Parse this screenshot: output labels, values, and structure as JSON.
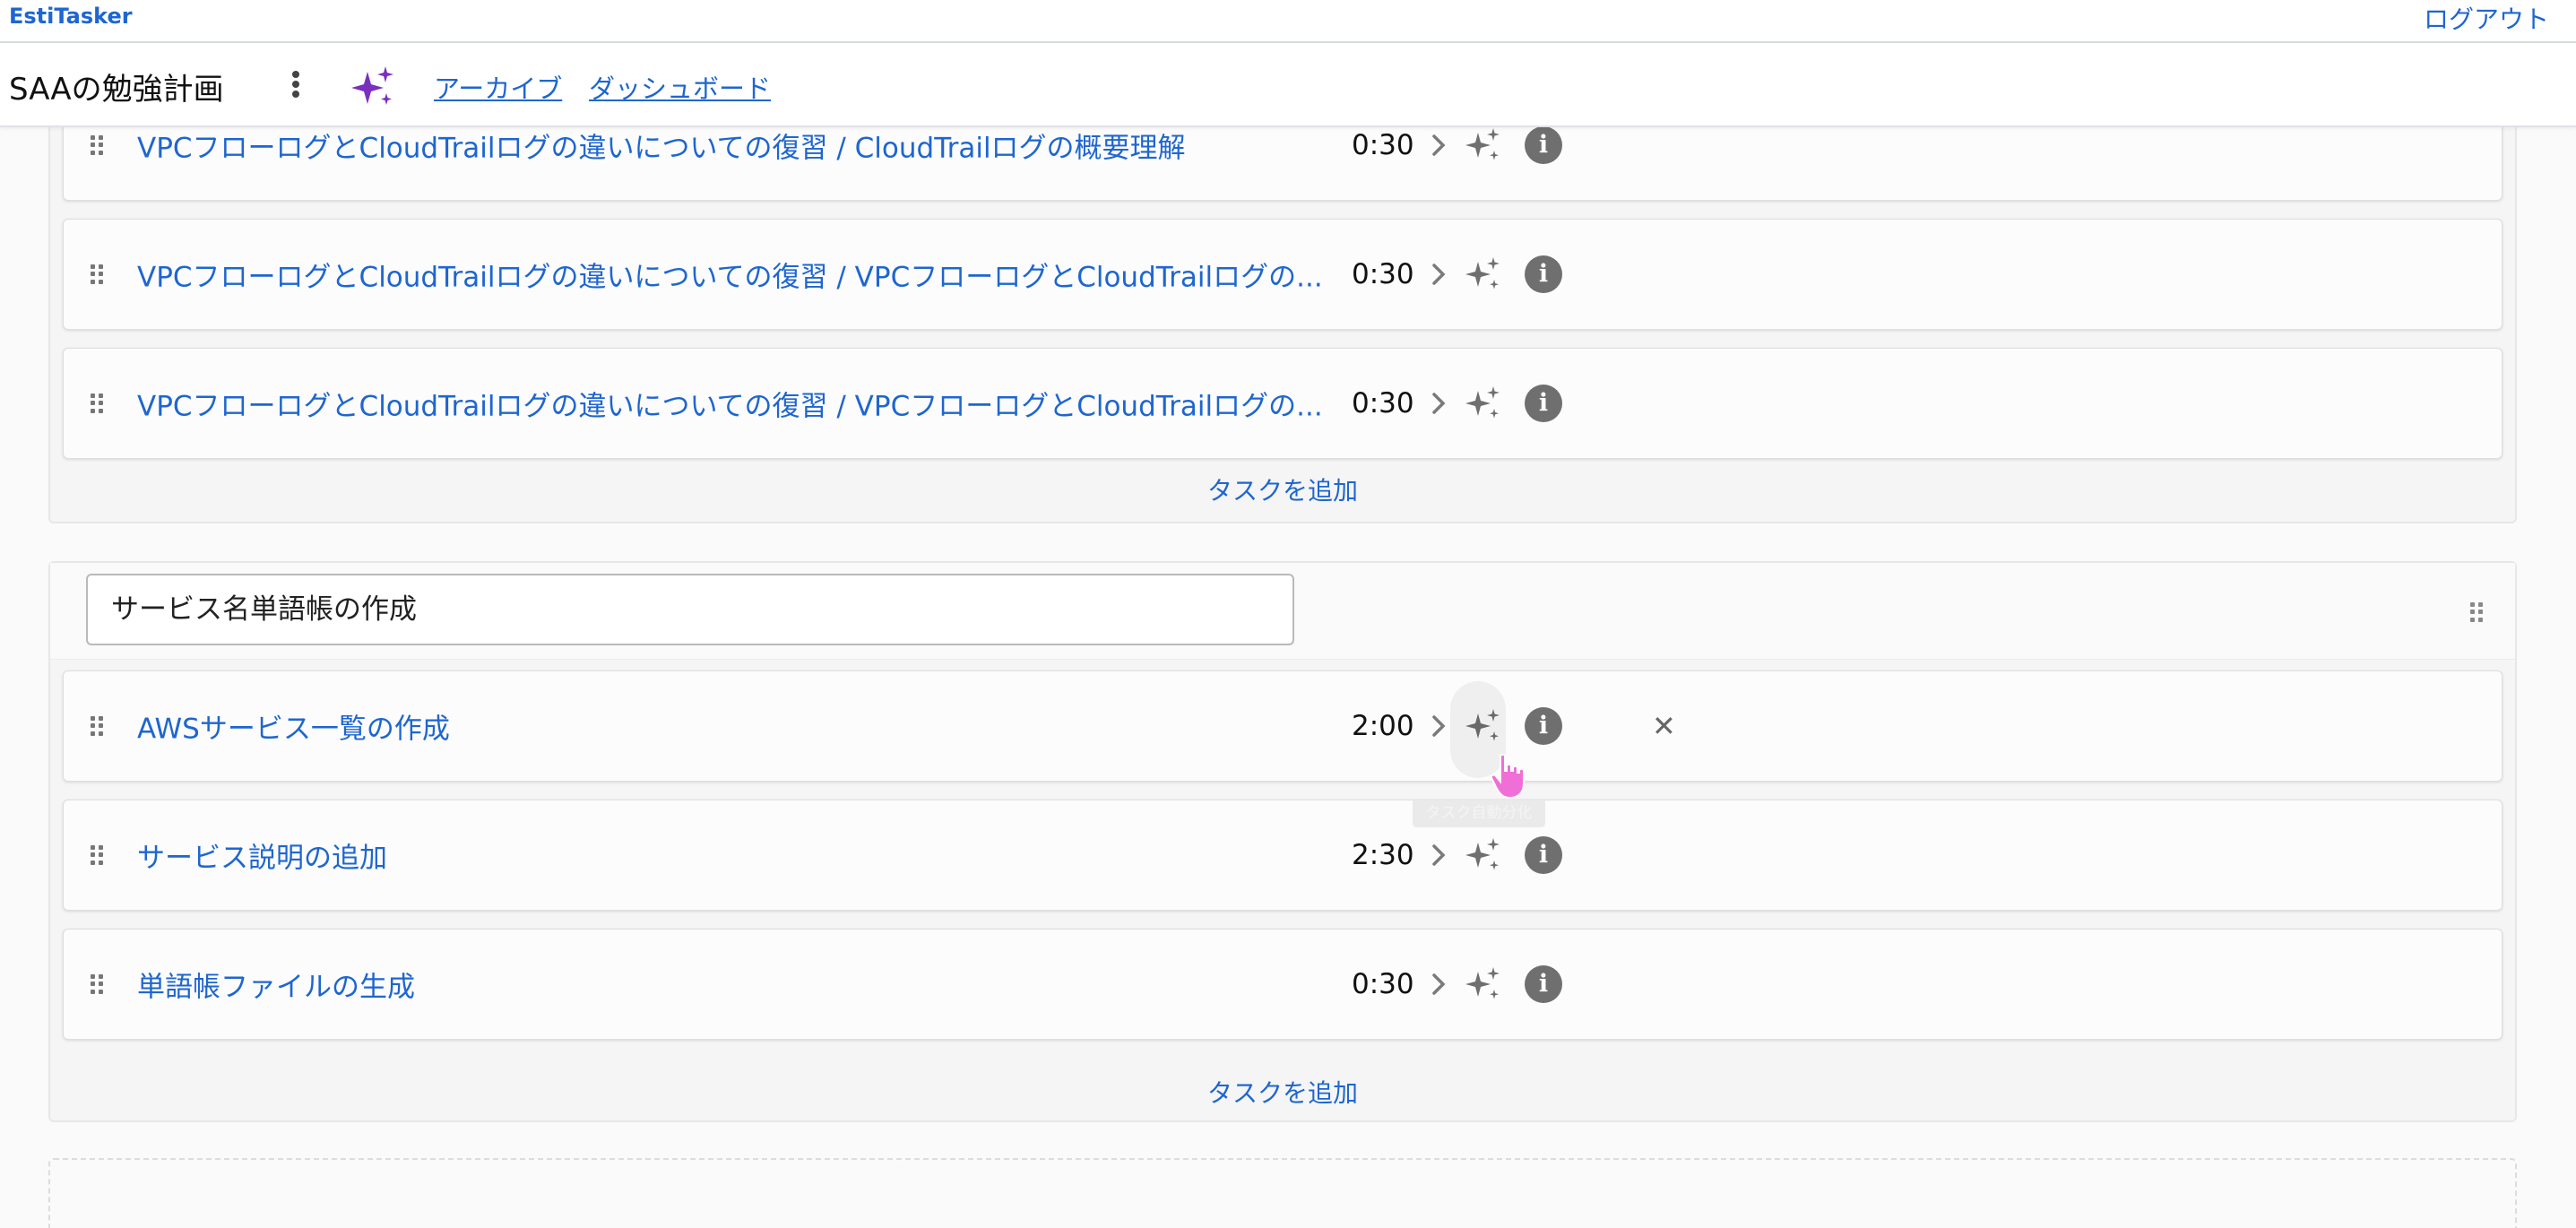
{
  "header": {
    "brand": "EstiTasker",
    "logout_label": "ログアウト"
  },
  "subheader": {
    "title": "SAAの勉強計画",
    "archive_label": "アーカイブ",
    "dashboard_label": "ダッシュボード"
  },
  "section1": {
    "tasks": [
      {
        "title": "VPCフローログとCloudTrailログの違いについての復習 / CloudTrailログの概要理解",
        "time": "0:30"
      },
      {
        "title": "VPCフローログとCloudTrailログの違いについての復習 / VPCフローログとCloudTrailログの...",
        "time": "0:30"
      },
      {
        "title": "VPCフローログとCloudTrailログの違いについての復習 / VPCフローログとCloudTrailログの...",
        "time": "0:30"
      }
    ],
    "add_task_label": "タスクを追加"
  },
  "section2": {
    "name": "サービス名単語帳の作成",
    "tasks": [
      {
        "title": "AWSサービス一覧の作成",
        "time": "2:00"
      },
      {
        "title": "サービス説明の追加",
        "time": "2:30"
      },
      {
        "title": "単語帳ファイルの生成",
        "time": "0:30"
      }
    ],
    "add_task_label": "タスクを追加",
    "tooltip": "タスク自動分化"
  },
  "icons": {
    "kebab": "kebab-menu-icon",
    "ai": "sparkle-icon",
    "chevron": "chevron-right-icon",
    "info": "info-icon",
    "close": "close-icon",
    "drag": "drag-handle-icon"
  },
  "colors": {
    "link": "#1e66d0",
    "ai_accent": "#7b2fbf",
    "icon_gray": "#6f6f6f"
  }
}
